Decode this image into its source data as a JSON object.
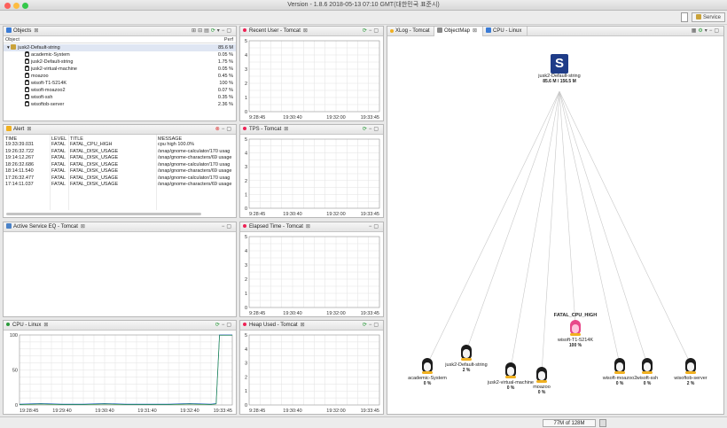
{
  "window": {
    "title": "Version - 1.8.6 2018-05-13 07:10 GMT(대한민국 표준시)"
  },
  "toolbar": {
    "service_label": "Service"
  },
  "objects": {
    "title": "Objects",
    "col_object": "Object",
    "col_perf": "Perf",
    "rows": [
      {
        "name": "jusk2-Default-string",
        "perf": "85.6 M",
        "level": 0
      },
      {
        "name": "academic-System",
        "perf": "0.05 %",
        "level": 1
      },
      {
        "name": "jusk2-Default-string",
        "perf": "1.75 %",
        "level": 1
      },
      {
        "name": "jusk2-virtual-machine",
        "perf": "0.05 %",
        "level": 1
      },
      {
        "name": "moazoo",
        "perf": "0.45 %",
        "level": 1
      },
      {
        "name": "wisoft-T1-5214K",
        "perf": "100 %",
        "level": 1
      },
      {
        "name": "wisoft-moazoo2",
        "perf": "0.07 %",
        "level": 1
      },
      {
        "name": "wisoft-ssh",
        "perf": "0.35 %",
        "level": 1
      },
      {
        "name": "wisoftob-server",
        "perf": "2.36 %",
        "level": 1
      }
    ]
  },
  "alert": {
    "title": "Alert",
    "cols": [
      "TIME",
      "LEVEL",
      "TITLE",
      "MESSAGE"
    ],
    "rows": [
      [
        "19:33:39.031",
        "FATAL",
        "FATAL_CPU_HIGH",
        "cpu high 100.0%"
      ],
      [
        "19:26:32.722",
        "FATAL",
        "FATAL_DISK_USAGE",
        "/snap/gnome-calculator/170 usag"
      ],
      [
        "19:14:12.267",
        "FATAL",
        "FATAL_DISK_USAGE",
        "/snap/gnome-characters/69 usage"
      ],
      [
        "18:26:32.686",
        "FATAL",
        "FATAL_DISK_USAGE",
        "/snap/gnome-calculator/170 usag"
      ],
      [
        "18:14:11.540",
        "FATAL",
        "FATAL_DISK_USAGE",
        "/snap/gnome-characters/69 usage"
      ],
      [
        "17:26:32.477",
        "FATAL",
        "FATAL_DISK_USAGE",
        "/snap/gnome-calculator/170 usag"
      ],
      [
        "17:14:11.037",
        "FATAL",
        "FATAL_DISK_USAGE",
        "/snap/gnome-characters/69 usage"
      ]
    ]
  },
  "active_service": {
    "title": "Active Service EQ - Tomcat"
  },
  "cpu_panel": {
    "title": "CPU - Linux"
  },
  "recent_user": {
    "title": "Recent User - Tomcat"
  },
  "tps": {
    "title": "TPS - Tomcat"
  },
  "elapsed": {
    "title": "Elapsed Time - Tomcat"
  },
  "heap": {
    "title": "Heap Used - Tomcat"
  },
  "objectmap": {
    "tabs": [
      "XLog - Tomcat",
      "ObjectMap",
      "CPU - Linux"
    ],
    "root": {
      "name": "jusk2-Default-string",
      "value": "85.6 M / 156.5 M"
    },
    "alert_label": "FATAL_CPU_HIGH",
    "nodes": [
      {
        "name": "academic-System",
        "value": "0 %"
      },
      {
        "name": "jusk2-Default-string",
        "value": "2 %"
      },
      {
        "name": "jusk2-virtual-machine",
        "value": "0 %"
      },
      {
        "name": "moazoo",
        "value": "0 %"
      },
      {
        "name": "wisoft-T1-5214K",
        "value": "100 %"
      },
      {
        "name": "wisoft-moazoo2",
        "value": "0 %"
      },
      {
        "name": "wisoft-ssh",
        "value": "0 %"
      },
      {
        "name": "wisoftob-server",
        "value": "2 %"
      }
    ]
  },
  "status": {
    "memory": "77M of 128M"
  },
  "chart_data": [
    {
      "chart": "cpu",
      "type": "line",
      "x_ticks": [
        "19:28:45",
        "19:29:40",
        "19:30:40",
        "19:31:40",
        "19:32:40",
        "19:33:45"
      ],
      "y_ticks": [
        "0",
        "50",
        "100"
      ],
      "ylim": [
        0,
        100
      ],
      "series": [
        {
          "x": [
            0,
            0.5,
            1,
            1.5,
            2,
            2.5,
            3,
            3.5,
            4,
            4.5,
            4.62,
            4.7,
            4.8,
            5
          ],
          "y": [
            1,
            2,
            1,
            1,
            2,
            1,
            1,
            1,
            2,
            1,
            2,
            100,
            100,
            100
          ]
        }
      ]
    },
    {
      "chart": "recent_user",
      "type": "line",
      "x_ticks": [
        "9:28:45",
        "19:30:40",
        "19:32:00",
        "19:33:45"
      ],
      "y_ticks": [
        "0",
        "1",
        "2",
        "3",
        "4",
        "5"
      ],
      "ylim": [
        0,
        5
      ]
    },
    {
      "chart": "tps",
      "type": "line",
      "x_ticks": [
        "9:28:45",
        "19:30:40",
        "19:32:00",
        "19:33:45"
      ],
      "y_ticks": [
        "0",
        "1",
        "2",
        "3",
        "4",
        "5"
      ],
      "ylim": [
        0,
        5
      ]
    },
    {
      "chart": "elapsed",
      "type": "line",
      "x_ticks": [
        "9:28:45",
        "19:30:40",
        "19:32:00",
        "19:33:45"
      ],
      "y_ticks": [
        "0",
        "1",
        "2",
        "3",
        "4",
        "5"
      ],
      "ylim": [
        0,
        5
      ]
    },
    {
      "chart": "heap",
      "type": "line",
      "x_ticks": [
        "9:28:45",
        "19:30:40",
        "19:32:00",
        "19:33:45"
      ],
      "y_ticks": [
        "0",
        "1",
        "2",
        "3",
        "4",
        "5"
      ],
      "ylim": [
        0,
        5
      ]
    }
  ]
}
